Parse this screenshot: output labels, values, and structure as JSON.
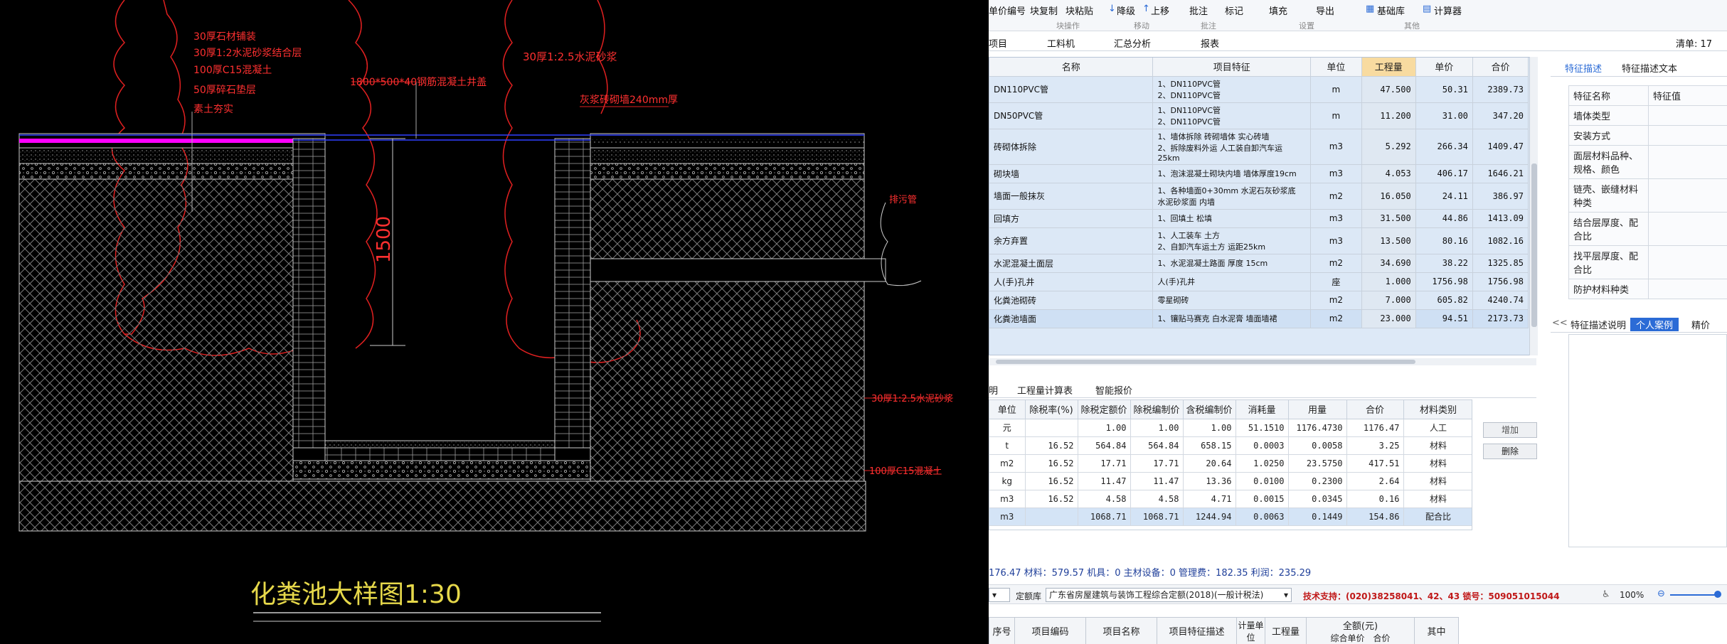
{
  "cad": {
    "title": "化粪池大样图1:30",
    "labels": {
      "layer1": "30厚石材铺装",
      "layer2": "30厚1:2水泥砂浆结合层",
      "layer3": "100厚C15混凝土",
      "layer4": "50厚碎石垫层",
      "layer5": "素土夯实",
      "pit": "1800*500*40钢筋混凝土井盖",
      "mortar_top": "30厚1:2.5水泥砂浆",
      "wall": "灰浆砖砌墙240mm厚",
      "pipe": "排污管",
      "dim": "1500",
      "mortar_right": "30厚1:2.5水泥砂浆",
      "concrete_right": "100厚C15混凝土"
    }
  },
  "ribbon": {
    "items": [
      "单价编号",
      "块复制",
      "块粘贴",
      "降级",
      "上移",
      "批注",
      "标记",
      "填充",
      "导出",
      "基础库",
      "计算器"
    ],
    "groups": [
      "块操作",
      "移动",
      "批注",
      "设置",
      "其他"
    ]
  },
  "tabs": [
    "项目",
    "工料机",
    "汇总分析",
    "报表"
  ],
  "list_count": "清单: 17",
  "grid": {
    "headers": [
      "名称",
      "项目特征",
      "单位",
      "工程量",
      "单价",
      "合价"
    ],
    "rows": [
      {
        "name": "DN110PVC管",
        "feat": "1、DN110PVC管\n2、DN110PVC管",
        "unit": "m",
        "qty": "47.500",
        "price": "50.31",
        "total": "2389.73"
      },
      {
        "name": "DN50PVC管",
        "feat": "1、DN110PVC管\n2、DN110PVC管",
        "unit": "m",
        "qty": "11.200",
        "price": "31.00",
        "total": "347.20"
      },
      {
        "name": "砖砌体拆除",
        "feat": "1、墙体拆除 砖砌墙体 实心砖墙\n2、拆除废料外运 人工装自卸汽车运 25km",
        "unit": "m3",
        "qty": "5.292",
        "price": "266.34",
        "total": "1409.47"
      },
      {
        "name": "砌块墙",
        "feat": "1、泡沫混凝土砌块内墙 墙体厚度19cm",
        "unit": "m3",
        "qty": "4.053",
        "price": "406.17",
        "total": "1646.21"
      },
      {
        "name": "墙面一般抹灰",
        "feat": "1、各种墙面0+30mm 水泥石灰砂浆底 水泥砂浆面 内墙",
        "unit": "m2",
        "qty": "16.050",
        "price": "24.11",
        "total": "386.97"
      },
      {
        "name": "回填方",
        "feat": "1、回填土 松填",
        "unit": "m3",
        "qty": "31.500",
        "price": "44.86",
        "total": "1413.09"
      },
      {
        "name": "余方弃置",
        "feat": "1、人工装车 土方\n2、自卸汽车运土方 运距25km",
        "unit": "m3",
        "qty": "13.500",
        "price": "80.16",
        "total": "1082.16"
      },
      {
        "name": "水泥混凝土面层",
        "feat": "1、水泥混凝土路面 厚度 15cm",
        "unit": "m2",
        "qty": "34.690",
        "price": "38.22",
        "total": "1325.85"
      },
      {
        "name": "人(手)孔井",
        "feat": "人(手)孔井",
        "unit": "座",
        "qty": "1.000",
        "price": "1756.98",
        "total": "1756.98"
      },
      {
        "name": "化粪池砌砖",
        "feat": "零星砌砖",
        "unit": "m2",
        "qty": "7.000",
        "price": "605.82",
        "total": "4240.74"
      },
      {
        "name": "化粪池墙面",
        "feat": "1、镶贴马赛克 白水泥膏 墙面墙裙",
        "unit": "m2",
        "qty": "23.000",
        "price": "94.51",
        "total": "2173.73"
      }
    ]
  },
  "side": {
    "tabs": [
      "特征描述",
      "特征描述文本"
    ],
    "headers": [
      "特征名称",
      "特征值"
    ],
    "features": [
      "墙体类型",
      "安装方式",
      "面层材料品种、规格、颜色",
      "链壳、嵌缝材料种类",
      "结合层厚度、配合比",
      "找平层厚度、配合比",
      "防护材料种类"
    ],
    "tabs2": [
      "<<",
      "特征描述说明",
      "个人案例",
      "精价"
    ]
  },
  "tabs2": [
    "明",
    "工程量计算表",
    "智能报价"
  ],
  "grid2": {
    "headers": [
      "单位",
      "除税率(%)",
      "除税定额价",
      "除税编制价",
      "含税编制价",
      "消耗量",
      "用量",
      "合价",
      "材料类别"
    ],
    "rows": [
      [
        "元",
        "",
        "1.00",
        "1.00",
        "1.00",
        "51.1510",
        "1176.4730",
        "1176.47",
        "人工"
      ],
      [
        "t",
        "16.52",
        "564.84",
        "564.84",
        "658.15",
        "0.0003",
        "0.0058",
        "3.25",
        "材料"
      ],
      [
        "m2",
        "16.52",
        "17.71",
        "17.71",
        "20.64",
        "1.0250",
        "23.5750",
        "417.51",
        "材料"
      ],
      [
        "kg",
        "16.52",
        "11.47",
        "11.47",
        "13.36",
        "0.0100",
        "0.2300",
        "2.64",
        "材料"
      ],
      [
        "m3",
        "16.52",
        "4.58",
        "4.58",
        "4.71",
        "0.0015",
        "0.0345",
        "0.16",
        "材料"
      ],
      [
        "m3",
        "",
        "1068.71",
        "1068.71",
        "1244.94",
        "0.0063",
        "0.1449",
        "154.86",
        "配合比"
      ]
    ],
    "add_btn": "增加",
    "del_btn": "删除"
  },
  "summary": "176.47  材料：579.57  机具：0  主材设备：0  管理费：182.35  利润：235.29",
  "status": {
    "quota_label": "定额库",
    "quota_value": "广东省房屋建筑与装饰工程综合定额(2018)(一般计税法)",
    "support": "技术支持：(020)38258041、42、43  锁号：509051015044",
    "zoom": "100%"
  },
  "bottom": {
    "headers": [
      "序号",
      "项目编码",
      "项目名称",
      "项目特征描述",
      "计量单位",
      "工程量",
      "全额(元)",
      "其中"
    ],
    "sub": [
      "综合单价",
      "合价"
    ]
  }
}
